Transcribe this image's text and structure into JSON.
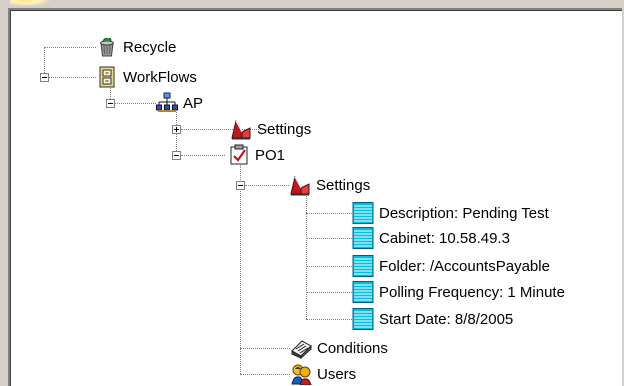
{
  "tree": {
    "recycle": "Recycle",
    "workflows": "WorkFlows",
    "ap": "AP",
    "ap_settings": "Settings",
    "po1": "PO1",
    "po1_settings": "Settings",
    "settings_items": [
      "Description: Pending Test",
      "Cabinet: 10.58.49.3",
      "Folder: /AccountsPayable",
      "Polling Frequency: 1 Minute",
      "Start Date: 8/8/2005"
    ],
    "conditions": "Conditions",
    "users": "Users"
  },
  "icons": {
    "recycle": "recycle-bin-icon",
    "workflows": "cabinet-icon",
    "ap": "network-icon",
    "settings": "red-book-icon",
    "po1": "checkbox-document-icon",
    "setting_item": "list-page-icon",
    "conditions": "notebook-icon",
    "users": "users-icon"
  },
  "colors": {
    "background": "#ffffff",
    "frame": "#d4d0c8",
    "settings_red": "#c0181f",
    "list_cyan": "#00c0e0"
  }
}
